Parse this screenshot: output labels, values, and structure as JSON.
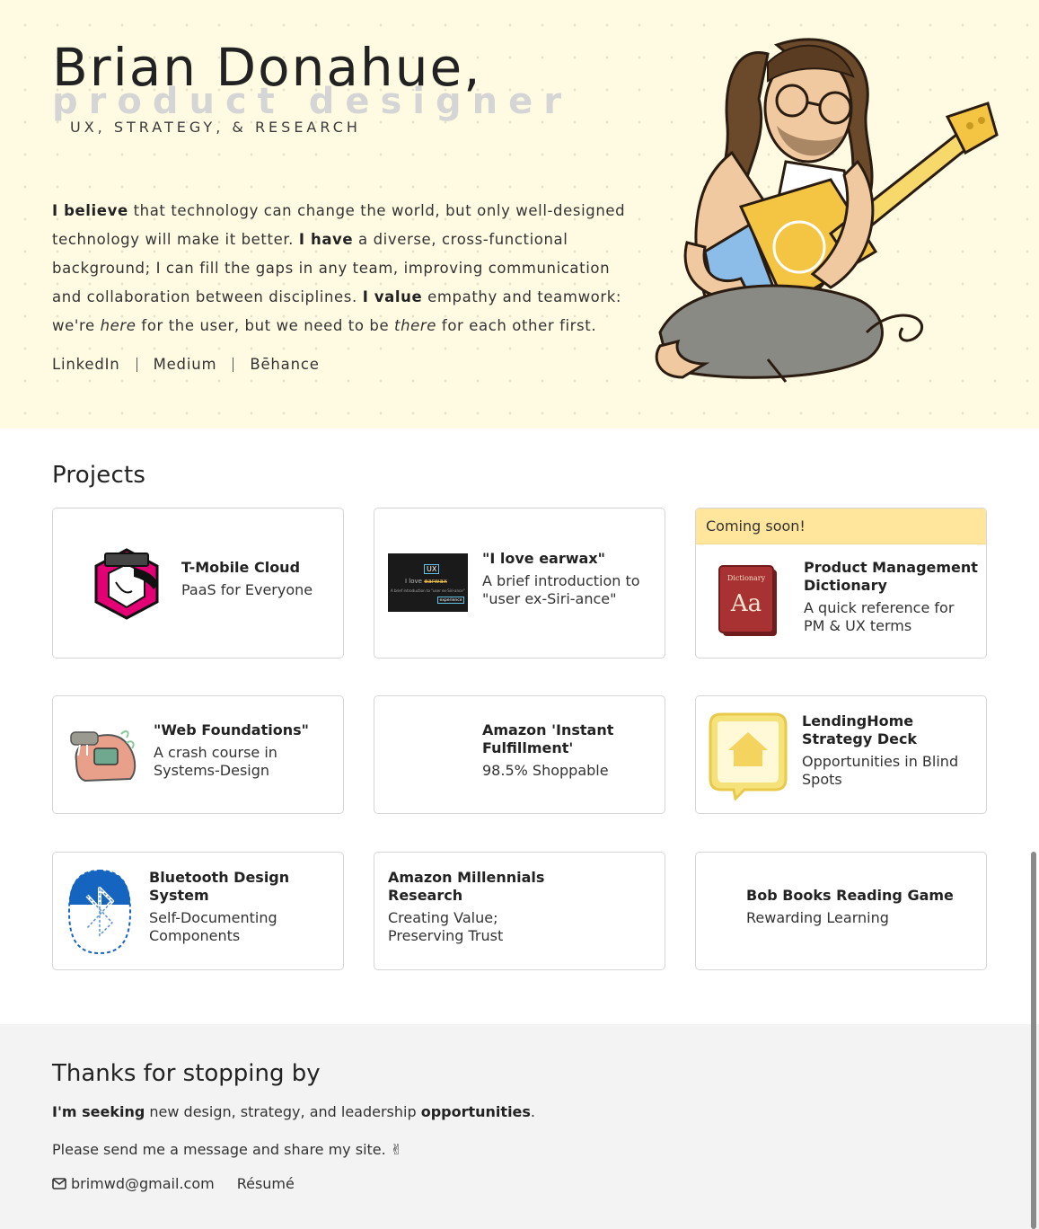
{
  "hero": {
    "name": "Brian Donahue,",
    "role": "product designer",
    "tagline": "UX, STRATEGY, & RESEARCH",
    "bio": {
      "p1_bold": "I believe",
      "p1": " that technology can change the world, but only well-designed technology will make it better. ",
      "p2_bold": "I have",
      "p2": " a diverse, cross-functional background; I can fill the gaps in any team, improving communication and collaboration between disciplines. ",
      "p3_bold": "I value",
      "p3": " empathy and teamwork: we're ",
      "here": "here",
      "p4": " for the user, but we need to be ",
      "there": "there",
      "p5": " for each other first."
    },
    "links": [
      "LinkedIn",
      "Medium",
      "Bēhance"
    ]
  },
  "projects": {
    "title": "Projects",
    "items": [
      {
        "title": "T-Mobile Cloud",
        "subtitle": "PaaS for Everyone",
        "icon": "tmobile-cloud-logo"
      },
      {
        "title": "\"I love earwax\"",
        "subtitle": "A brief introduction to \"user ex-Siri-ance\"",
        "icon": "earwax-slide-thumbnail",
        "thumb_text": {
          "badge": "UX",
          "line": "I love",
          "struck": "earwax",
          "caption": "A brief introduction to \"user ex-Siri-ance\"",
          "tag": "experience"
        }
      },
      {
        "title": "Product Management Dictionary",
        "subtitle": "A quick reference for PM & UX terms",
        "icon": "dictionary-book-icon",
        "banner": "Coming soon!",
        "book_title": "Dictionary",
        "book_letters": "Aa"
      },
      {
        "title": "\"Web Foundations\"",
        "subtitle": "A crash course in Systems-Design",
        "icon": "walrus-illustration"
      },
      {
        "title": "Amazon 'Instant Fulfillment'",
        "subtitle": "98.5% Shoppable"
      },
      {
        "title": "LendingHome Strategy Deck",
        "subtitle": "Opportunities in Blind Spots",
        "icon": "house-speech-bubble-icon"
      },
      {
        "title": "Bluetooth Design System",
        "subtitle": "Self-Documenting Components",
        "icon": "bluetooth-icon"
      },
      {
        "title": "Amazon Millennials Research",
        "subtitle": "Creating Value; Preserving Trust"
      },
      {
        "title": "Bob Books Reading Game",
        "subtitle": "Rewarding Learning"
      }
    ]
  },
  "footer": {
    "title": "Thanks for stopping by",
    "seeking_bold": "I'm seeking",
    "seeking_mid": " new design, strategy, and leadership ",
    "seeking_bold2": "opportunities",
    "seeking_end": ".",
    "message": "Please send me a message and share my site. ✌",
    "email": "brimwd@gmail.com",
    "resume": "Résumé"
  },
  "colors": {
    "hero_bg": "#fffbe3",
    "banner": "#ffe69c",
    "footer_bg": "#f3f3f3",
    "tmobile_magenta": "#e20074",
    "bluetooth_blue": "#1565c0"
  }
}
